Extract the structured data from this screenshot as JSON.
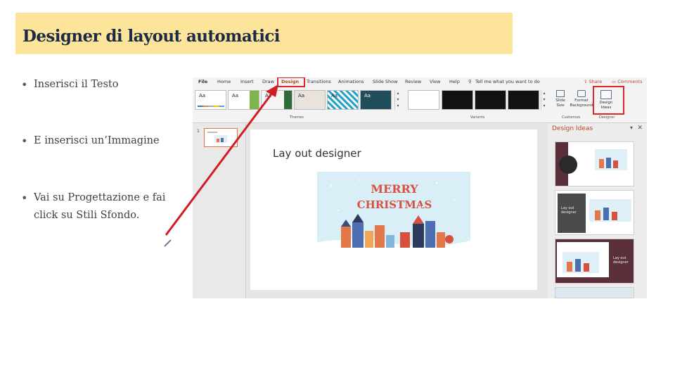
{
  "title": "Designer di layout automatici",
  "bullets": [
    "Inserisci il Testo",
    "E inserisci un’Immagine",
    "Vai su Progettazione e fai click su Stili Sfondo."
  ],
  "ppt": {
    "tabs": [
      "File",
      "Home",
      "Insert",
      "Draw",
      "Design",
      "Transitions",
      "Animations",
      "Slide Show",
      "Review",
      "View",
      "Help",
      "Tell me what you want to do"
    ],
    "active_tab": "Design",
    "share": "Share",
    "comments": "Comments",
    "theme_thumb_label": "Aa",
    "groups": {
      "themes": "Themes",
      "variants": "Variants",
      "customize": "Customize",
      "designer": "Designer"
    },
    "buttons": {
      "slide_size": "Slide Size",
      "format_background": "Format Background",
      "design_ideas": "Design Ideas"
    },
    "slide_number": "1",
    "slide_title": "Lay out designer",
    "slide_art_text_line1": "MERRY",
    "slide_art_text_line2": "CHRISTMAS",
    "design_pane_title": "Design Ideas",
    "idea_label": "Lay out designer"
  },
  "colors": {
    "title_band": "#fce49b",
    "title_text": "#1e2a44",
    "highlight_red": "#e0262b",
    "arrow_red": "#d01d24",
    "ppt_accent": "#b7472a"
  }
}
